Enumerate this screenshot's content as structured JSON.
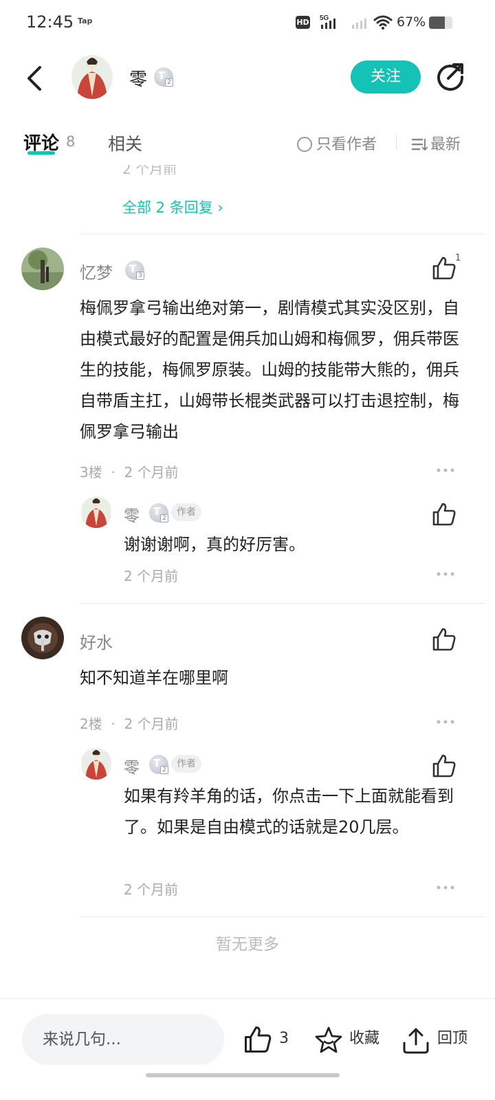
{
  "status_bar": {
    "time": "12:45",
    "notification": "Tap",
    "hd_label": "HD",
    "network": "5G",
    "battery": "67%",
    "battery_level": 0.67
  },
  "header": {
    "author_name": "零",
    "author_level": "2",
    "follow_label": "关注"
  },
  "tabs": {
    "comments_label": "评论",
    "comments_count": "8",
    "related_label": "相关",
    "author_only_label": "只看作者",
    "sort_label": "最新"
  },
  "thread_top": {
    "cut_off_text": "2 个月前",
    "view_replies": "全部 2 条回复 ›"
  },
  "comments": [
    {
      "user": "忆梦",
      "level": "3",
      "text": "梅佩罗拿弓输出绝对第一，剧情模式其实没区别，自由模式最好的配置是佣兵加山姆和梅佩罗，佣兵带医生的技能，梅佩罗原装。山姆的技能带大熊的，佣兵自带盾主扛，山姆带长棍类武器可以打击退控制，梅佩罗拿弓输出",
      "floor": "3楼",
      "time": "2 个月前",
      "likes": "1",
      "reply": {
        "user": "零",
        "level": "2",
        "tag": "作者",
        "text": "谢谢谢啊，真的好厉害。",
        "time": "2 个月前"
      }
    },
    {
      "user": "好水",
      "text": "知不知道羊在哪里啊",
      "floor": "2楼",
      "time": "2 个月前",
      "reply": {
        "user": "零",
        "level": "2",
        "tag": "作者",
        "text": "如果有羚羊角的话，你点击一下上面就能看到了。如果是自由模式的话就是20几层。",
        "time": "2 个月前"
      }
    }
  ],
  "meta_separator": "·",
  "no_more": "暂无更多",
  "bottom_bar": {
    "input_placeholder": "来说几句...",
    "like_count": "3",
    "favorite_label": "收藏",
    "back_top_label": "回顶"
  },
  "colors": {
    "accent": "#14c3b5",
    "text_primary": "#222222",
    "text_secondary": "#888888"
  }
}
